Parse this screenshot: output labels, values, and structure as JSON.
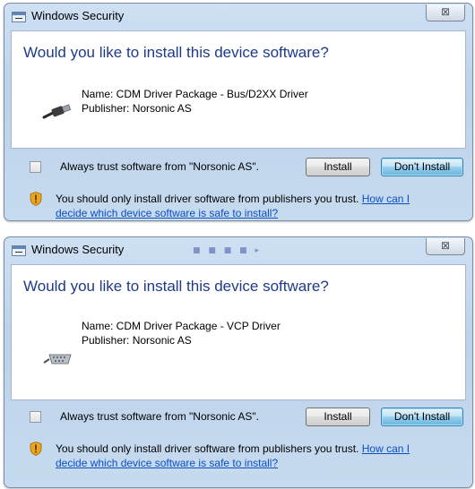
{
  "dialogs": [
    {
      "title": "Windows Security",
      "close_glyph": "⊠",
      "question": "Would you like to install this device software?",
      "name_line": "Name: CDM Driver Package - Bus/D2XX Driver",
      "publisher_line": "Publisher: Norsonic AS",
      "device_icon": "usb-cable-icon",
      "trust_checkbox": {
        "checked": false,
        "label": "Always trust software from \"Norsonic AS\"."
      },
      "install_button": "Install",
      "dont_install_button": "Don't Install",
      "warning_text": "You should only install driver software from publishers you trust.",
      "warning_link_1": "How can I",
      "warning_link_2": "decide which device software is safe to install?"
    },
    {
      "title": "Windows Security",
      "close_glyph": "⊠",
      "question": "Would you like to install this device software?",
      "name_line": "Name: CDM Driver Package - VCP Driver",
      "publisher_line": "Publisher: Norsonic AS",
      "device_icon": "serial-port-icon",
      "trust_checkbox": {
        "checked": false,
        "label": "Always trust software from \"Norsonic AS\"."
      },
      "install_button": "Install",
      "dont_install_button": "Don't Install",
      "warning_text": "You should only install driver software from publishers you trust.",
      "warning_link_1": "How can I",
      "warning_link_2": "decide which device software is safe to install?"
    }
  ],
  "colors": {
    "heading": "#1e3a8a",
    "link": "#0b4fc2",
    "frame": "#bcd2ea"
  }
}
